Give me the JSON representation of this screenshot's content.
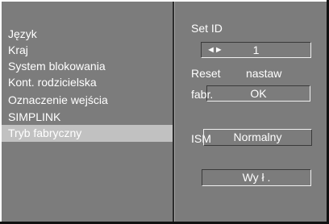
{
  "menu": {
    "items": [
      {
        "label": "Język"
      },
      {
        "label": "Kraj"
      },
      {
        "label": "System blokowania"
      },
      {
        "label": "Kont. rodzicielska"
      },
      {
        "label": "Oznaczenie wejścia"
      },
      {
        "label": "SIMPLINK"
      },
      {
        "label": "Tryb fabryczny",
        "selected": true
      }
    ]
  },
  "panel": {
    "set_id_label": "Set ID",
    "set_id_arrows": "◄►",
    "set_id_value": "1",
    "reset_label": "Reset",
    "nastaw_label": "nastaw",
    "fabr_label": "fabr.",
    "ok_label": "OK",
    "ism_label": "ISM",
    "ism_value": "Normalny",
    "off_label": "Wy ł ."
  },
  "colors": {
    "background": "#7c7c7c",
    "selected_row": "#c1c1c1",
    "text": "#ffffff"
  }
}
